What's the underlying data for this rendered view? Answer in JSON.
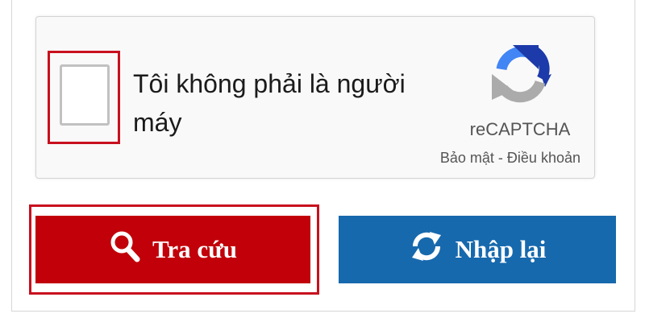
{
  "captcha": {
    "label": "Tôi không phải là người máy",
    "brand": "reCAPTCHA",
    "privacy_link": "Bảo mật",
    "separator": " - ",
    "terms_link": "Điều khoản"
  },
  "buttons": {
    "search_label": "Tra cứu",
    "reset_label": "Nhập lại"
  },
  "colors": {
    "search_bg": "#c10009",
    "reset_bg": "#1769ad",
    "highlight": "#c8101e",
    "recaptcha_blue": "#1c3aa9",
    "recaptcha_light_blue": "#4285f4",
    "recaptcha_gray": "#ababab"
  },
  "icons": {
    "search": "magnifier-icon",
    "reset": "refresh-icon",
    "logo": "recaptcha-logo-icon"
  }
}
